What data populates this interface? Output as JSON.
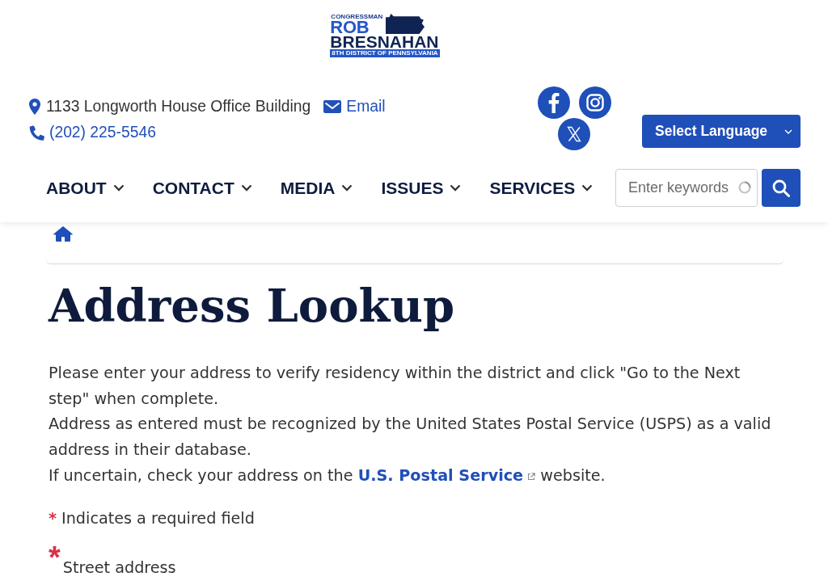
{
  "logo": {
    "overline": "CONGRESSMAN",
    "first_name": "ROB",
    "last_name": "BRESNAHAN",
    "tagline": "8TH DISTRICT OF PENNSYLVANIA"
  },
  "contact": {
    "address": "1133 Longworth House Office Building",
    "email": "Email",
    "phone": "(202) 225-5546"
  },
  "language_select": {
    "label": "Select Language"
  },
  "nav": [
    {
      "label": "ABOUT"
    },
    {
      "label": "CONTACT"
    },
    {
      "label": "MEDIA"
    },
    {
      "label": "ISSUES"
    },
    {
      "label": "SERVICES"
    }
  ],
  "search": {
    "placeholder": "Enter keywords"
  },
  "page": {
    "title": "Address Lookup",
    "paragraphs": [
      "Please enter your address to verify residency within the district and click \"Go to the Next step\" when complete.",
      "Address as entered must be recognized by the United States Postal Service (USPS) as a valid address in their database."
    ],
    "usps_note": {
      "before": "If uncertain, check your address on the",
      "link": "U.S. Postal Service",
      "after": "website."
    }
  },
  "required_note": {
    "mark": "*",
    "text": "Indicates a required field"
  },
  "form": {
    "fields": [
      {
        "label": "Street address",
        "required_mark": "*"
      }
    ]
  }
}
